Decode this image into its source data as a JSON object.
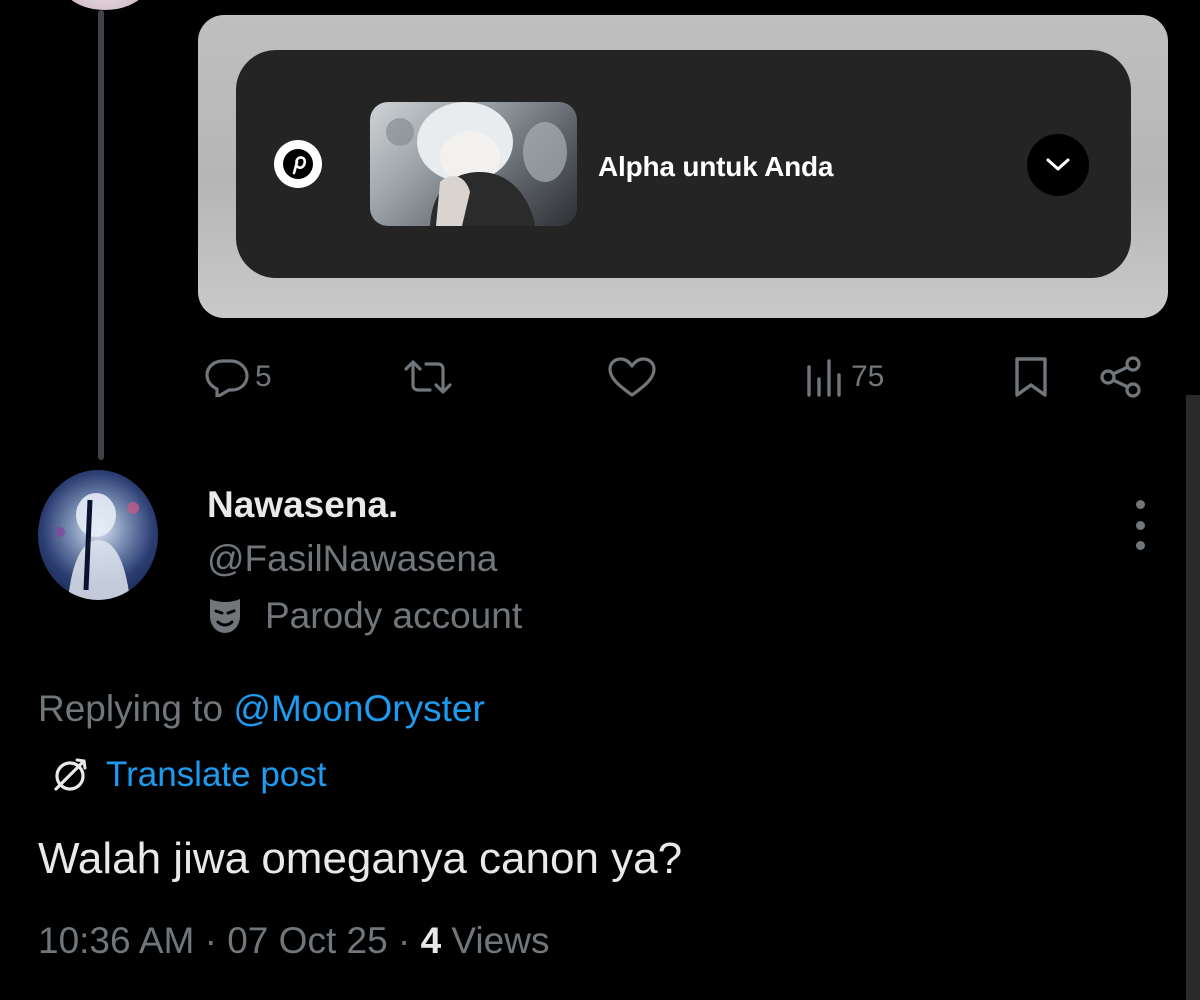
{
  "card": {
    "title": "Alpha untuk Anda"
  },
  "actions": {
    "replies": "5",
    "views": "75"
  },
  "reply": {
    "display_name": "Nawasena.",
    "handle": "@FasilNawasena",
    "badge": "Parody account",
    "replying_prefix": "Replying to",
    "replying_mention": "@MoonOryster",
    "translate": "Translate post",
    "text": "Walah jiwa omeganya canon ya?",
    "time": "10:36 AM",
    "date": "07 Oct 25",
    "views_count": "4",
    "views_label": "Views"
  },
  "colors": {
    "background": "#000000",
    "muted": "#71767b",
    "link": "#1d9bf0",
    "text": "#e7e9ea"
  },
  "icons": [
    "pinterest-icon",
    "chevron-down-icon",
    "reply-icon",
    "retweet-icon",
    "like-icon",
    "views-icon",
    "bookmark-icon",
    "share-icon",
    "mask-icon",
    "translate-icon",
    "more-icon"
  ]
}
